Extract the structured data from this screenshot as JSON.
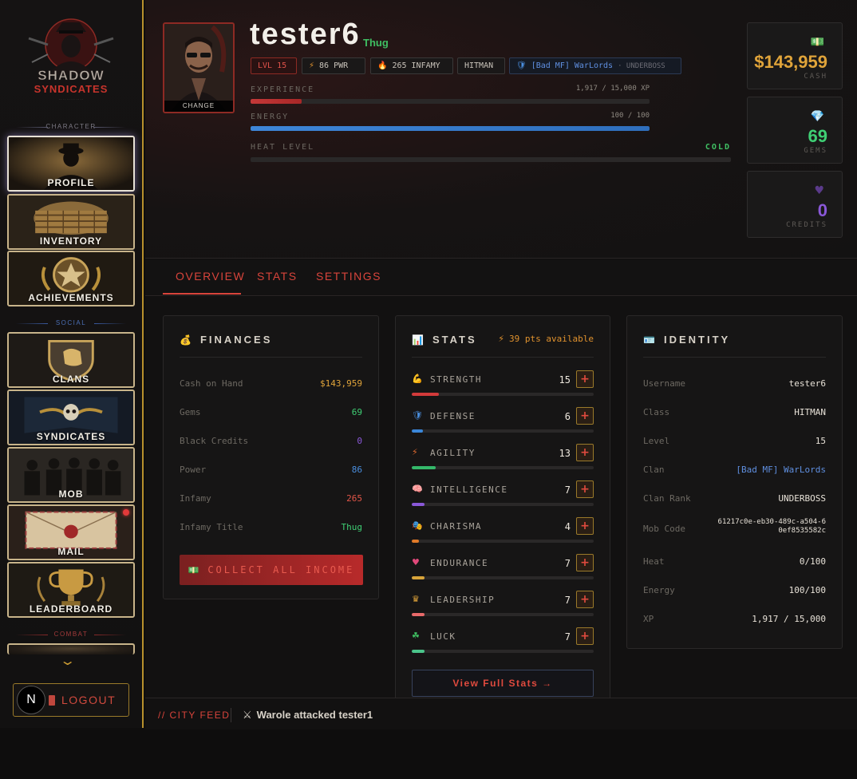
{
  "sidebar": {
    "logo_text": "SHADOW SYNDICATES",
    "sections": {
      "character": "CHARACTER",
      "social": "SOCIAL",
      "combat": "COMBAT"
    },
    "items": [
      {
        "label": "PROFILE",
        "active": true
      },
      {
        "label": "INVENTORY"
      },
      {
        "label": "ACHIEVEMENTS"
      },
      {
        "label": "CLANS"
      },
      {
        "label": "SYNDICATES"
      },
      {
        "label": "MOB"
      },
      {
        "label": "MAIL",
        "notification": true
      },
      {
        "label": "LEADERBOARD"
      }
    ],
    "logout_label": "LOGOUT",
    "n_badge": "N"
  },
  "profile": {
    "avatar_change_label": "CHANGE",
    "username": "tester6",
    "title": "Thug",
    "badges": {
      "level": "LVL 15",
      "power": "86 PWR",
      "infamy": "265 INFAMY",
      "class": "HITMAN",
      "clan": "[Bad MF] WarLords",
      "clan_rank": "· UNDERBOSS"
    },
    "experience": {
      "label": "EXPERIENCE",
      "value_text": "1,917 / 15,000 XP",
      "fraction": 0.1278
    },
    "energy": {
      "label": "ENERGY",
      "value_text": "100 / 100",
      "fraction": 1.0
    },
    "heat": {
      "label": "HEAT LEVEL",
      "status": "COLD",
      "fraction": 0.0
    }
  },
  "currency": {
    "cash": {
      "value": "$143,959",
      "label": "CASH",
      "icon": "money-icon",
      "color": "#e0a43a"
    },
    "gems": {
      "value": "69",
      "label": "GEMS",
      "icon": "gem-icon",
      "color": "#3fcf74"
    },
    "credits": {
      "value": "0",
      "label": "CREDITS",
      "icon": "heart-icon",
      "color": "#8a58d8"
    }
  },
  "tabs": [
    "OVERVIEW",
    "STATS",
    "SETTINGS"
  ],
  "finances": {
    "title": "FINANCES",
    "rows": [
      {
        "label": "Cash on Hand",
        "value": "$143,959",
        "color": "#e0a43a"
      },
      {
        "label": "Gems",
        "value": "69",
        "color": "#3fcf74"
      },
      {
        "label": "Black Credits",
        "value": "0",
        "color": "#8a58d8"
      },
      {
        "label": "Power",
        "value": "86",
        "color": "#4a8fe0"
      },
      {
        "label": "Infamy",
        "value": "265",
        "color": "#e25548"
      },
      {
        "label": "Infamy Title",
        "value": "Thug",
        "color": "#3fcf74"
      }
    ],
    "collect_label": "COLLECT ALL INCOME"
  },
  "stats": {
    "title": "STATS",
    "available": "39 pts available",
    "rows": [
      {
        "name": "STRENGTH",
        "value": "15",
        "fraction": 0.15,
        "color": "#d23a3a"
      },
      {
        "name": "DEFENSE",
        "value": "6",
        "fraction": 0.06,
        "color": "#3a86d8"
      },
      {
        "name": "AGILITY",
        "value": "13",
        "fraction": 0.13,
        "color": "#34b86a"
      },
      {
        "name": "INTELLIGENCE",
        "value": "7",
        "fraction": 0.07,
        "color": "#8a58d8"
      },
      {
        "name": "CHARISMA",
        "value": "4",
        "fraction": 0.04,
        "color": "#e07a28"
      },
      {
        "name": "ENDURANCE",
        "value": "7",
        "fraction": 0.07,
        "color": "#d8a43a"
      },
      {
        "name": "LEADERSHIP",
        "value": "7",
        "fraction": 0.07,
        "color": "#e86a6a"
      },
      {
        "name": "LUCK",
        "value": "7",
        "fraction": 0.07,
        "color": "#4ac48a"
      }
    ],
    "view_full_label": "View Full Stats →"
  },
  "identity": {
    "title": "IDENTITY",
    "rows": [
      {
        "label": "Username",
        "value": "tester6",
        "color": "#e8e2d8"
      },
      {
        "label": "Class",
        "value": "HITMAN",
        "color": "#e8e2d8"
      },
      {
        "label": "Level",
        "value": "15",
        "color": "#e8e2d8"
      },
      {
        "label": "Clan",
        "value": "[Bad MF] WarLords",
        "color": "#5f8fe0"
      },
      {
        "label": "Clan Rank",
        "value": "UNDERBOSS",
        "color": "#e8e2d8"
      },
      {
        "label": "Mob Code",
        "value": "61217c0e-eb30-489c-a504-60ef8535582c",
        "color": "#e8e2d8"
      },
      {
        "label": "Heat",
        "value": "0/100",
        "color": "#e8e2d8"
      },
      {
        "label": "Energy",
        "value": "100/100",
        "color": "#e8e2d8"
      },
      {
        "label": "XP",
        "value": "1,917 / 15,000",
        "color": "#e8e2d8"
      }
    ]
  },
  "feed": {
    "label": "// CITY FEED",
    "item": "Warole attacked tester1"
  }
}
